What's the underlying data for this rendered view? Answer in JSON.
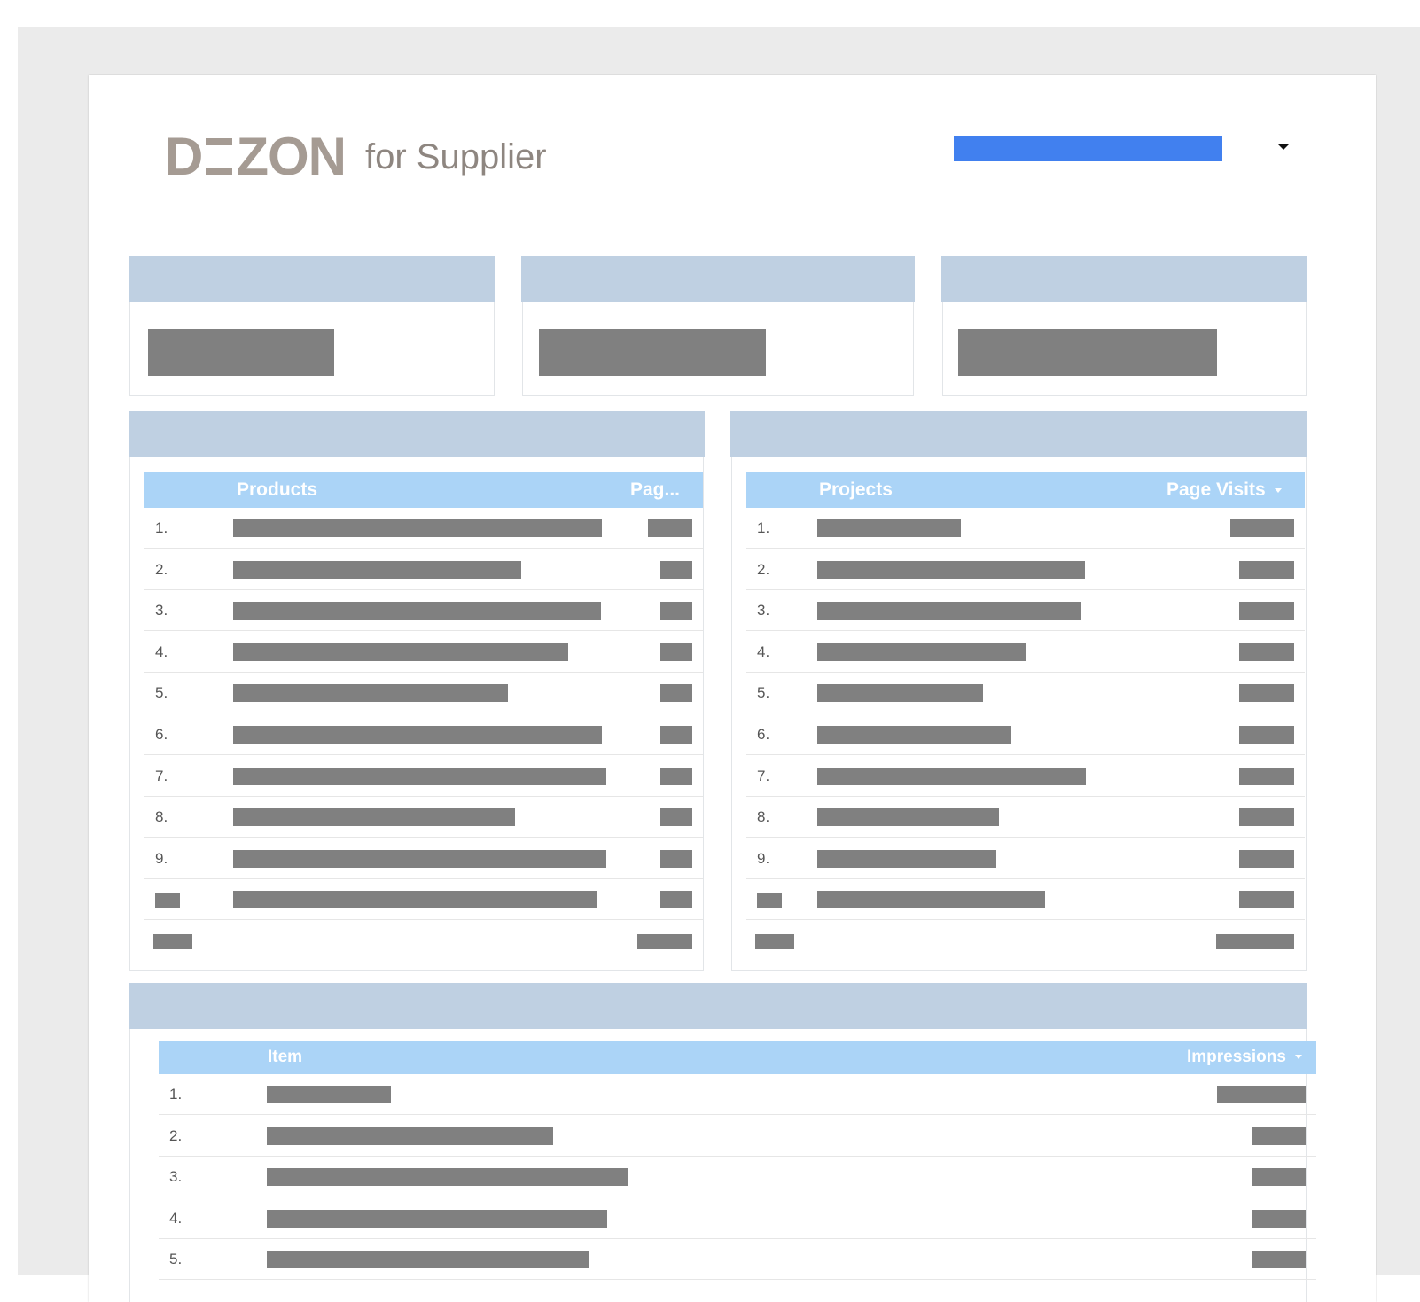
{
  "header": {
    "brand_logo": "DEZON",
    "brand_sub": "for Supplier"
  },
  "colors": {
    "selector": "#4180ef",
    "card_header": "#bfd0e2",
    "table_header": "#abd4f7",
    "redacted": "#808080"
  },
  "products_table": {
    "col_name": "Products",
    "col_value": "Pag...",
    "rows": [
      {
        "num": "1."
      },
      {
        "num": "2."
      },
      {
        "num": "3."
      },
      {
        "num": "4."
      },
      {
        "num": "5."
      },
      {
        "num": "6."
      },
      {
        "num": "7."
      },
      {
        "num": "8."
      },
      {
        "num": "9."
      },
      {
        "num": ""
      }
    ]
  },
  "projects_table": {
    "col_name": "Projects",
    "col_value": "Page Visits",
    "rows": [
      {
        "num": "1."
      },
      {
        "num": "2."
      },
      {
        "num": "3."
      },
      {
        "num": "4."
      },
      {
        "num": "5."
      },
      {
        "num": "6."
      },
      {
        "num": "7."
      },
      {
        "num": "8."
      },
      {
        "num": "9."
      },
      {
        "num": ""
      }
    ]
  },
  "items_table": {
    "col_name": "Item",
    "col_value": "Impressions",
    "rows": [
      {
        "num": "1."
      },
      {
        "num": "2."
      },
      {
        "num": "3."
      },
      {
        "num": "4."
      },
      {
        "num": "5."
      }
    ]
  }
}
